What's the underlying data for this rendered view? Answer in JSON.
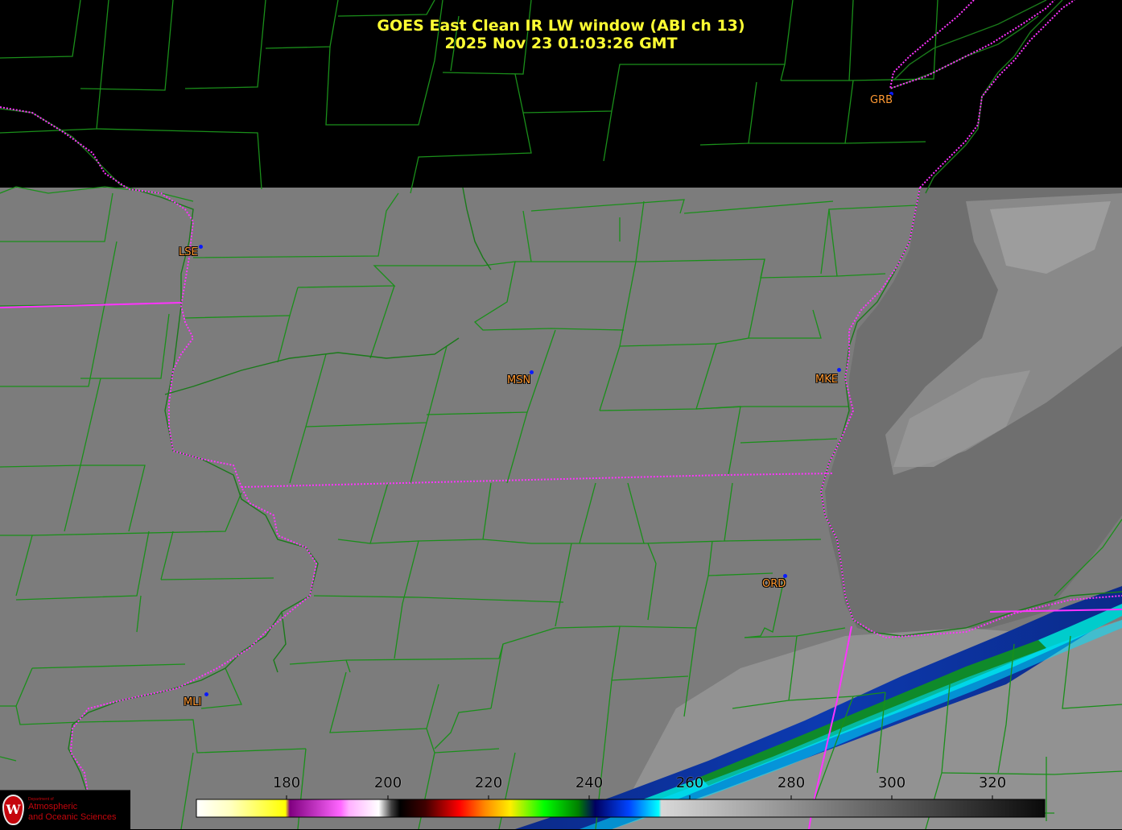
{
  "title": {
    "line1": "GOES East Clean IR LW window (ABI ch 13)",
    "line2": "2025 Nov 23  01:03:26 GMT"
  },
  "stations": [
    {
      "id": "GRB"
    },
    {
      "id": "LSE"
    },
    {
      "id": "MSN"
    },
    {
      "id": "MKE"
    },
    {
      "id": "ORD"
    },
    {
      "id": "MLI"
    }
  ],
  "colorbar": {
    "ticks": [
      "180",
      "200",
      "220",
      "240",
      "260",
      "280",
      "300",
      "320"
    ],
    "range": [
      163,
      330
    ]
  },
  "logo": {
    "dept": "Department of",
    "line1": "Atmospheric",
    "line2": "and Oceanic Sciences",
    "shield_letter": "W"
  },
  "colors": {
    "county_lines": "#1a8f1a",
    "state_lines": "#ff33ff",
    "title": "#ffff33",
    "station_label": "#ff9933",
    "station_dot": "#0a1aff",
    "land_gray": "#7c7c7c",
    "lake_gray": "#777777"
  }
}
